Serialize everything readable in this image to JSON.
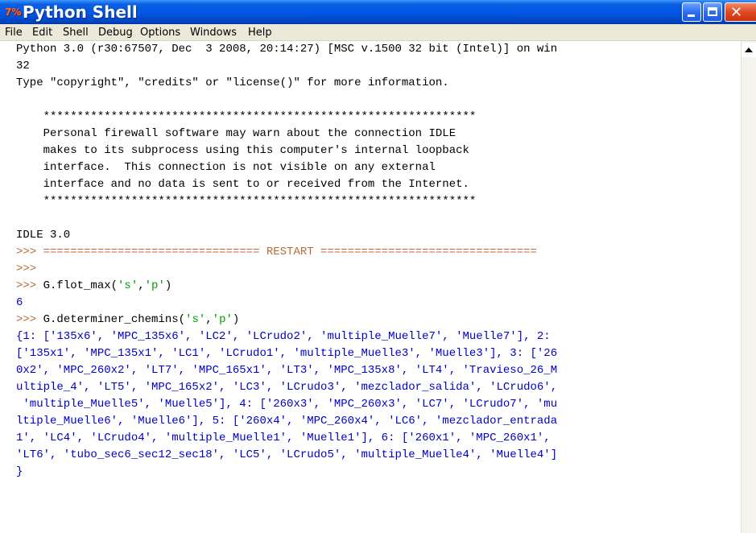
{
  "window": {
    "title": "Python Shell",
    "icon_label": "7%"
  },
  "menu": [
    "File",
    "Edit",
    "Shell",
    "Debug",
    "Options",
    "Windows",
    "Help"
  ],
  "shell": {
    "lines": [
      [
        {
          "t": "Python 3.0 (r30:67507, Dec  3 2008, 20:14:27) [MSC v.1500 32 bit (Intel)] on win",
          "c": "out"
        }
      ],
      [
        {
          "t": "32",
          "c": "out"
        }
      ],
      [
        {
          "t": "Type \"copyright\", \"credits\" or \"license()\" for more information.",
          "c": "out"
        }
      ],
      [
        {
          "t": "",
          "c": "out"
        }
      ],
      [
        {
          "t": "    ****************************************************************",
          "c": "out"
        }
      ],
      [
        {
          "t": "    Personal firewall software may warn about the connection IDLE",
          "c": "out"
        }
      ],
      [
        {
          "t": "    makes to its subprocess using this computer's internal loopback",
          "c": "out"
        }
      ],
      [
        {
          "t": "    interface.  This connection is not visible on any external",
          "c": "out"
        }
      ],
      [
        {
          "t": "    interface and no data is sent to or received from the Internet.",
          "c": "out"
        }
      ],
      [
        {
          "t": "    ****************************************************************",
          "c": "out"
        }
      ],
      [
        {
          "t": "",
          "c": "out"
        }
      ],
      [
        {
          "t": "IDLE 3.0",
          "c": "out"
        }
      ],
      [
        {
          "t": ">>> ================================ RESTART ================================",
          "c": "prompt"
        }
      ],
      [
        {
          "t": ">>> ",
          "c": "prompt"
        }
      ],
      [
        {
          "t": ">>> ",
          "c": "prompt"
        },
        {
          "t": "G.flot_max(",
          "c": "code"
        },
        {
          "t": "'s'",
          "c": "str"
        },
        {
          "t": ",",
          "c": "code"
        },
        {
          "t": "'p'",
          "c": "str"
        },
        {
          "t": ")",
          "c": "code"
        }
      ],
      [
        {
          "t": "6",
          "c": "stdout"
        }
      ],
      [
        {
          "t": ">>> ",
          "c": "prompt"
        },
        {
          "t": "G.determiner_chemins(",
          "c": "code"
        },
        {
          "t": "'s'",
          "c": "str"
        },
        {
          "t": ",",
          "c": "code"
        },
        {
          "t": "'p'",
          "c": "str"
        },
        {
          "t": ")",
          "c": "code"
        }
      ],
      [
        {
          "t": "{1: ['135x6', 'MPC_135x6', 'LC2', 'LCrudo2', 'multiple_Muelle7', 'Muelle7'], 2:",
          "c": "stdout"
        }
      ],
      [
        {
          "t": "['135x1', 'MPC_135x1', 'LC1', 'LCrudo1', 'multiple_Muelle3', 'Muelle3'], 3: ['26",
          "c": "stdout"
        }
      ],
      [
        {
          "t": "0x2', 'MPC_260x2', 'LT7', 'MPC_165x1', 'LT3', 'MPC_135x8', 'LT4', 'Travieso_26_M",
          "c": "stdout"
        }
      ],
      [
        {
          "t": "ultiple_4', 'LT5', 'MPC_165x2', 'LC3', 'LCrudo3', 'mezclador_salida', 'LCrudo6',",
          "c": "stdout"
        }
      ],
      [
        {
          "t": " 'multiple_Muelle5', 'Muelle5'], 4: ['260x3', 'MPC_260x3', 'LC7', 'LCrudo7', 'mu",
          "c": "stdout"
        }
      ],
      [
        {
          "t": "ltiple_Muelle6', 'Muelle6'], 5: ['260x4', 'MPC_260x4', 'LC6', 'mezclador_entrada",
          "c": "stdout"
        }
      ],
      [
        {
          "t": "1', 'LC4', 'LCrudo4', 'multiple_Muelle1', 'Muelle1'], 6: ['260x1', 'MPC_260x1',",
          "c": "stdout"
        }
      ],
      [
        {
          "t": "'LT6', 'tubo_sec6_sec12_sec18', 'LC5', 'LCrudo5', 'multiple_Muelle4', 'Muelle4']",
          "c": "stdout"
        }
      ],
      [
        {
          "t": "}",
          "c": "stdout"
        }
      ]
    ]
  }
}
